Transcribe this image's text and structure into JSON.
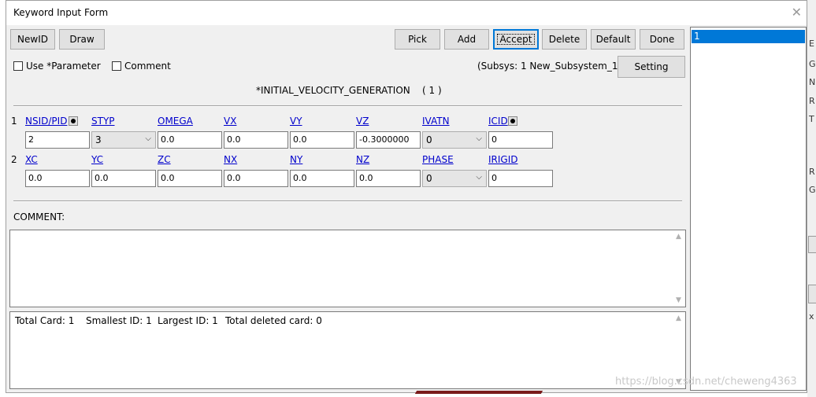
{
  "window": {
    "title": "Keyword Input Form",
    "close_glyph": "✕"
  },
  "toolbar": {
    "newid": "NewID",
    "draw": "Draw",
    "pick": "Pick",
    "add": "Add",
    "accept": "Accept",
    "delete": "Delete",
    "default": "Default",
    "done": "Done",
    "setting": "Setting"
  },
  "options": {
    "use_parameter": "Use *Parameter",
    "comment": "Comment",
    "subsys": "(Subsys: 1 New_Subsystem_1)"
  },
  "keyword": {
    "name": "*INITIAL_VELOCITY_GENERATION",
    "count": "( 1 )"
  },
  "cards": [
    {
      "num": "1",
      "fields": [
        {
          "label": "NSID/PID",
          "value": "2",
          "type": "input",
          "pick": true
        },
        {
          "label": "STYP",
          "value": "3",
          "type": "select"
        },
        {
          "label": "OMEGA",
          "value": "0.0",
          "type": "input"
        },
        {
          "label": "VX",
          "value": "0.0",
          "type": "input"
        },
        {
          "label": "VY",
          "value": "0.0",
          "type": "input"
        },
        {
          "label": "VZ",
          "value": "-0.3000000",
          "type": "input"
        },
        {
          "label": "IVATN",
          "value": "0",
          "type": "select"
        },
        {
          "label": "ICID",
          "value": "0",
          "type": "input",
          "pick": true
        }
      ]
    },
    {
      "num": "2",
      "fields": [
        {
          "label": "XC",
          "value": "0.0",
          "type": "input"
        },
        {
          "label": "YC",
          "value": "0.0",
          "type": "input"
        },
        {
          "label": "ZC",
          "value": "0.0",
          "type": "input"
        },
        {
          "label": "NX",
          "value": "0.0",
          "type": "input"
        },
        {
          "label": "NY",
          "value": "0.0",
          "type": "input"
        },
        {
          "label": "NZ",
          "value": "0.0",
          "type": "input"
        },
        {
          "label": "PHASE",
          "value": "0",
          "type": "select"
        },
        {
          "label": "IRIGID",
          "value": "0",
          "type": "input"
        }
      ]
    }
  ],
  "comment_label": "COMMENT:",
  "status": {
    "total_card": "Total Card: 1",
    "smallest_id": "Smallest ID: 1",
    "largest_id": "Largest ID: 1",
    "total_deleted": "Total deleted card:  0"
  },
  "id_list": {
    "items": [
      "1"
    ],
    "selected": "1"
  },
  "watermark": "https://blog.csdn.net/cheweng4363",
  "icons": {
    "checkbox": "checkbox-icon",
    "dropdown": "chevron-down-icon",
    "pick": "pick-dot-icon",
    "scroll_up": "scroll-up-icon",
    "scroll_down": "scroll-down-icon"
  },
  "colors": {
    "selection": "#0078d7",
    "link": "#0000cc",
    "window_bg": "#f0f0f0"
  }
}
